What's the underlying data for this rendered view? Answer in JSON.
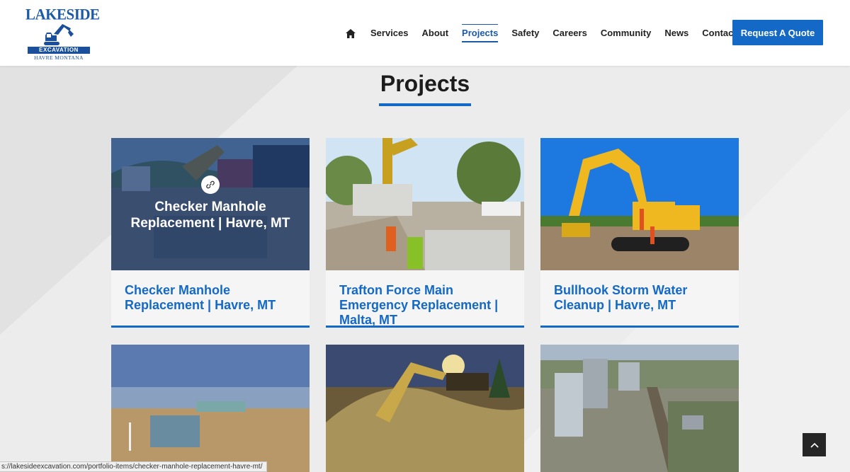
{
  "logo": {
    "top": "LAKESIDE",
    "middle": "EXCAVATION",
    "bottom": "HAVRE MONTANA"
  },
  "nav": {
    "items": [
      {
        "label": "Services"
      },
      {
        "label": "About"
      },
      {
        "label": "Projects",
        "active": true
      },
      {
        "label": "Safety"
      },
      {
        "label": "Careers"
      },
      {
        "label": "Community"
      },
      {
        "label": "News"
      },
      {
        "label": "Contact"
      }
    ],
    "cta": "Request A Quote"
  },
  "page": {
    "title": "Projects"
  },
  "projects": [
    {
      "title": "Checker Manhole Replacement | Havre, MT"
    },
    {
      "title": "Trafton Force Main Emergency Replacement | Malta, MT"
    },
    {
      "title": "Bullhook Storm Water Cleanup | Havre, MT"
    }
  ],
  "hover_overlay": {
    "title": "Checker Manhole Replacement | Havre, MT",
    "icon": "link-icon"
  },
  "status_bar": {
    "url": "s://lakesideexcavation.com/portfolio-items/checker-manhole-replacement-havre-mt/"
  },
  "colors": {
    "accent": "#1469c7",
    "title_text": "#1c1c1c",
    "background": "#ececec"
  }
}
